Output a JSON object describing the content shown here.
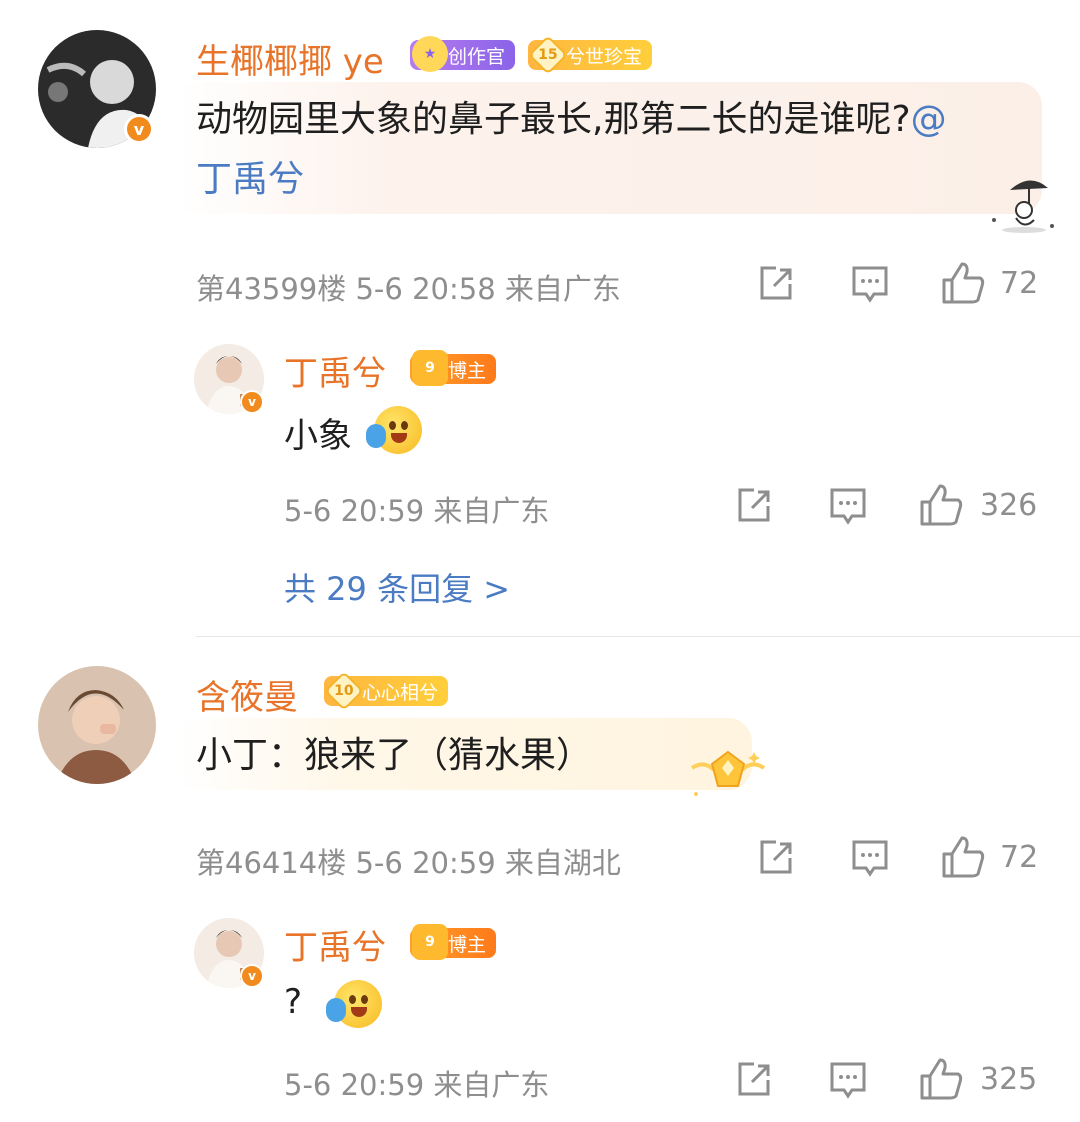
{
  "comments": [
    {
      "username": "生椰椰揶 ye",
      "badges": [
        "创作官",
        "兮世珍宝"
      ],
      "fan_level": "15",
      "text": "动物园里大象的鼻子最长,那第二长的是谁呢?",
      "mention": "@丁禹兮",
      "floor": "第43599楼",
      "time": "5-6 20:58",
      "location": "来自广东",
      "likes": "72",
      "reply": {
        "username": "丁禹兮",
        "badge": "博主",
        "text": "小象",
        "time": "5-6 20:59",
        "location": "来自广东",
        "likes": "326"
      },
      "more_replies": "共 29 条回复 >"
    },
    {
      "username": "含筱曼",
      "badges": [
        "心心相兮"
      ],
      "fan_level": "10",
      "text": "小丁：狼来了（猜水果）",
      "floor": "第46414楼",
      "time": "5-6 20:59",
      "location": "来自湖北",
      "likes": "72",
      "reply": {
        "username": "丁禹兮",
        "badge": "博主",
        "text": "?",
        "time": "5-6 20:59",
        "location": "来自广东",
        "likes": "325"
      }
    }
  ],
  "verified_mark": "v",
  "host_badge_icon": "9",
  "icons": {
    "share": "share-icon",
    "comment": "comment-icon",
    "like": "thumbs-up-icon"
  }
}
